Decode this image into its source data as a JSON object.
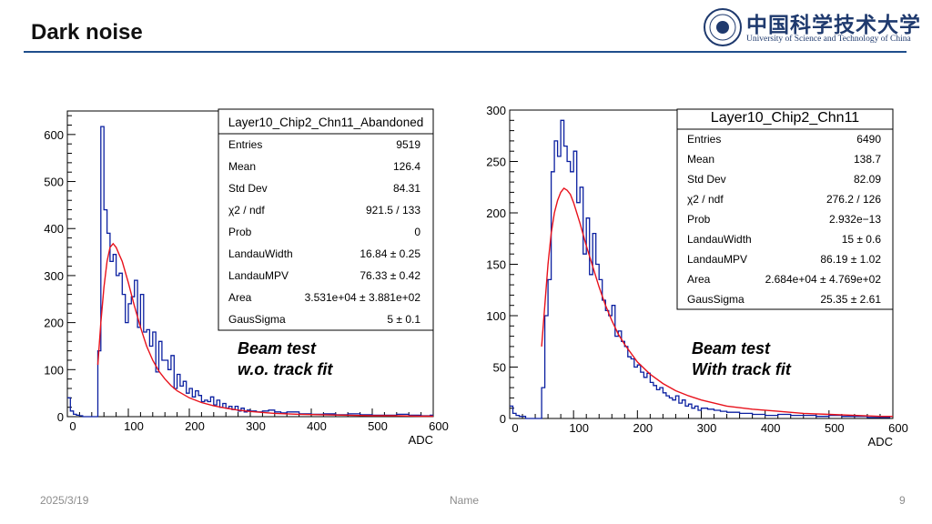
{
  "slide": {
    "title": "Dark noise",
    "logo_cn": "中国科学技术大学",
    "logo_en": "University of Science and Technology of China",
    "date": "2025/3/19",
    "footer_name": "Name",
    "page_number": "9"
  },
  "colors": {
    "histogram": "#0a1fa0",
    "fit": "#e8121c",
    "rule": "#1f4e8c"
  },
  "chart_data": [
    {
      "type": "histogram",
      "title": "Layer10_Chip2_Chn11_Abandoned",
      "xlabel": "ADC",
      "ylabel": "",
      "xlim": [
        0,
        600
      ],
      "ylim": [
        0,
        650
      ],
      "x_ticks": [
        "0",
        "100",
        "200",
        "300",
        "400",
        "500",
        "600"
      ],
      "y_ticks": [
        "0",
        "100",
        "200",
        "300",
        "400",
        "500",
        "600"
      ],
      "bin_width": 5,
      "stats": [
        {
          "label": "Entries",
          "value": "9519"
        },
        {
          "label": "Mean",
          "value": "126.4"
        },
        {
          "label": "Std Dev",
          "value": "84.31"
        },
        {
          "label": "χ2 / ndf",
          "value": "921.5 / 133"
        },
        {
          "label": "Prob",
          "value": "0"
        },
        {
          "label": "LandauWidth",
          "value": "16.84 ± 0.25"
        },
        {
          "label": "LandauMPV",
          "value": "76.33 ± 0.42"
        },
        {
          "label": "Area",
          "value": "3.531e+04 ± 3.881e+02"
        },
        {
          "label": "GausSigma",
          "value": "5 ± 0.1"
        }
      ],
      "annotation": [
        "Beam test",
        "w.o. track fit"
      ],
      "bins_x": [
        -10,
        -5,
        0,
        5,
        10,
        15,
        20,
        25,
        30,
        35,
        40,
        45,
        50,
        55,
        60,
        65,
        70,
        75,
        80,
        85,
        90,
        95,
        100,
        105,
        110,
        115,
        120,
        125,
        130,
        135,
        140,
        145,
        150,
        155,
        160,
        165,
        170,
        175,
        180,
        185,
        190,
        195,
        200,
        205,
        210,
        215,
        220,
        225,
        230,
        235,
        240,
        245,
        250,
        255,
        260,
        265,
        270,
        275,
        280,
        285,
        290,
        295,
        300,
        310,
        320,
        330,
        340,
        350,
        360,
        370,
        380,
        390,
        400,
        420,
        440,
        460,
        480,
        500,
        520,
        540,
        560,
        580,
        595
      ],
      "counts": [
        8,
        30,
        40,
        12,
        5,
        3,
        2,
        0,
        0,
        0,
        0,
        0,
        140,
        617,
        440,
        390,
        330,
        345,
        300,
        305,
        260,
        200,
        240,
        255,
        290,
        190,
        260,
        180,
        185,
        150,
        180,
        95,
        160,
        120,
        120,
        100,
        130,
        60,
        90,
        65,
        75,
        50,
        60,
        42,
        55,
        45,
        32,
        35,
        32,
        42,
        25,
        35,
        20,
        28,
        18,
        22,
        15,
        22,
        12,
        18,
        10,
        14,
        12,
        10,
        12,
        14,
        10,
        8,
        10,
        10,
        6,
        6,
        5,
        6,
        4,
        6,
        4,
        3,
        3,
        5,
        3,
        2,
        3
      ],
      "fit": {
        "x": [
          50,
          55,
          60,
          65,
          70,
          75,
          80,
          85,
          90,
          100,
          110,
          120,
          130,
          140,
          150,
          160,
          170,
          180,
          200,
          220,
          240,
          260,
          280,
          300,
          340,
          380,
          420,
          460,
          500,
          540,
          580,
          600
        ],
        "y": [
          110,
          200,
          275,
          330,
          360,
          368,
          360,
          345,
          330,
          285,
          235,
          190,
          150,
          120,
          97,
          80,
          66,
          55,
          40,
          30,
          23,
          18,
          14,
          11,
          7,
          5,
          4,
          3,
          2,
          2,
          1,
          1
        ]
      }
    },
    {
      "type": "histogram",
      "title": "Layer10_Chip2_Chn11",
      "xlabel": "ADC",
      "ylabel": "",
      "xlim": [
        0,
        600
      ],
      "ylim": [
        0,
        300
      ],
      "x_ticks": [
        "0",
        "100",
        "200",
        "300",
        "400",
        "500",
        "600"
      ],
      "y_ticks": [
        "0",
        "50",
        "100",
        "150",
        "200",
        "250",
        "300"
      ],
      "bin_width": 5,
      "stats": [
        {
          "label": "Entries",
          "value": "6490"
        },
        {
          "label": "Mean",
          "value": "138.7"
        },
        {
          "label": "Std Dev",
          "value": "82.09"
        },
        {
          "label": "χ2 / ndf",
          "value": "276.2 / 126"
        },
        {
          "label": "Prob",
          "value": "2.932e−13"
        },
        {
          "label": "LandauWidth",
          "value": "15 ± 0.6"
        },
        {
          "label": "LandauMPV",
          "value": "86.19 ± 1.02"
        },
        {
          "label": "Area",
          "value": "2.684e+04 ± 4.769e+02"
        },
        {
          "label": "GausSigma",
          "value": "25.35 ± 2.61"
        }
      ],
      "annotation": [
        "Beam test",
        "With track fit"
      ],
      "bins_x": [
        -10,
        -5,
        0,
        5,
        10,
        15,
        20,
        25,
        30,
        35,
        40,
        45,
        50,
        55,
        60,
        65,
        70,
        75,
        80,
        85,
        90,
        95,
        100,
        105,
        110,
        115,
        120,
        125,
        130,
        135,
        140,
        145,
        150,
        155,
        160,
        165,
        170,
        175,
        180,
        185,
        190,
        195,
        200,
        205,
        210,
        215,
        220,
        225,
        230,
        235,
        240,
        245,
        250,
        255,
        260,
        265,
        270,
        275,
        280,
        285,
        290,
        295,
        300,
        310,
        320,
        330,
        340,
        350,
        360,
        370,
        380,
        390,
        400,
        420,
        440,
        460,
        480,
        500,
        520,
        540,
        560,
        580,
        595
      ],
      "counts": [
        20,
        15,
        12,
        5,
        3,
        2,
        2,
        0,
        0,
        0,
        0,
        0,
        30,
        100,
        135,
        240,
        270,
        255,
        290,
        265,
        250,
        240,
        260,
        210,
        225,
        160,
        195,
        140,
        180,
        150,
        135,
        115,
        105,
        100,
        110,
        80,
        85,
        75,
        70,
        60,
        58,
        50,
        52,
        45,
        40,
        44,
        35,
        32,
        28,
        30,
        25,
        22,
        20,
        18,
        22,
        15,
        18,
        12,
        14,
        10,
        12,
        8,
        10,
        9,
        8,
        7,
        6,
        6,
        5,
        5,
        4,
        4,
        3,
        4,
        3,
        3,
        2,
        3,
        2,
        2,
        1,
        1,
        2
      ],
      "fit": {
        "x": [
          50,
          55,
          60,
          65,
          70,
          75,
          80,
          85,
          90,
          95,
          100,
          110,
          120,
          130,
          140,
          150,
          160,
          170,
          180,
          200,
          220,
          240,
          260,
          280,
          300,
          340,
          380,
          420,
          460,
          500,
          540,
          580,
          600
        ],
        "y": [
          70,
          110,
          150,
          180,
          200,
          212,
          220,
          224,
          222,
          218,
          210,
          190,
          168,
          148,
          128,
          110,
          95,
          82,
          72,
          55,
          43,
          34,
          27,
          22,
          18,
          12,
          9,
          7,
          5,
          4,
          3,
          2,
          2
        ]
      }
    }
  ]
}
